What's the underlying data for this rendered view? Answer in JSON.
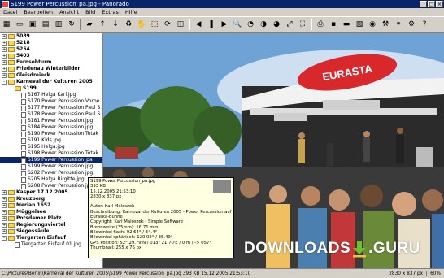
{
  "window": {
    "title": "S199 Power Percussion_pa.jpg - Panorado",
    "controls": [
      "_",
      "□",
      "×"
    ]
  },
  "menu": [
    "Datei",
    "Bearbeiten",
    "Ansicht",
    "Bild",
    "Extras",
    "Hilfe"
  ],
  "toolbar": [
    "grid-icon",
    "monitor-icon",
    "image-icon",
    "filmstrip-icon",
    "slideshow-icon",
    "refresh-icon",
    "new-folder-icon",
    "up-icon",
    "down-icon",
    "recycle-icon",
    "hand-icon",
    "zoom-region-icon",
    "rotate-icon",
    "crop-icon",
    "prev-icon",
    "pause-icon",
    "next-icon",
    "zoom-icon",
    "zoom-50-icon",
    "zoom-100-icon",
    "zoom-200-icon",
    "fit-icon",
    "fullscreen-icon",
    "print-icon",
    "save-icon",
    "scanner-icon",
    "photo-icon",
    "camera-icon",
    "tools-icon",
    "link-icon",
    "settings-icon",
    "question-icon"
  ],
  "tree": [
    {
      "label": "5089",
      "indent": 1,
      "exp": "+",
      "kind": "folder",
      "bold": true
    },
    {
      "label": "5218",
      "indent": 1,
      "exp": "+",
      "kind": "folder",
      "bold": true
    },
    {
      "label": "5254",
      "indent": 1,
      "exp": "+",
      "kind": "folder",
      "bold": true
    },
    {
      "label": "5403",
      "indent": 1,
      "exp": "+",
      "kind": "folder",
      "bold": true
    },
    {
      "label": "Fernsehturm",
      "indent": 1,
      "exp": "+",
      "kind": "folder",
      "bold": true
    },
    {
      "label": "Friedenau Winterbilder",
      "indent": 1,
      "exp": "+",
      "kind": "folder",
      "bold": true
    },
    {
      "label": "Gleisdreieck",
      "indent": 1,
      "exp": "+",
      "kind": "folder",
      "bold": true
    },
    {
      "label": "Karneval der Kulturen 2005",
      "indent": 1,
      "exp": "-",
      "kind": "folder",
      "bold": true
    },
    {
      "label": "S199",
      "indent": 2,
      "exp": "",
      "kind": "folder",
      "bold": true
    },
    {
      "label": "S167 Helga Karl.jpg",
      "indent": 3,
      "exp": "",
      "kind": "file"
    },
    {
      "label": "S170 Power Percussion Vorbe",
      "indent": 3,
      "exp": "",
      "kind": "file"
    },
    {
      "label": "S177 Power Percussion Paul S",
      "indent": 3,
      "exp": "",
      "kind": "file"
    },
    {
      "label": "S178 Power Percussion Paul S",
      "indent": 3,
      "exp": "",
      "kind": "file"
    },
    {
      "label": "S181 Power Percussion.jpg",
      "indent": 3,
      "exp": "",
      "kind": "file"
    },
    {
      "label": "S184 Power Percussion.jpg",
      "indent": 3,
      "exp": "",
      "kind": "file"
    },
    {
      "label": "S190 Power Percussion Totak",
      "indent": 3,
      "exp": "",
      "kind": "file"
    },
    {
      "label": "S191 Kids.jpg",
      "indent": 3,
      "exp": "",
      "kind": "file"
    },
    {
      "label": "S195 Helga.jpg",
      "indent": 3,
      "exp": "",
      "kind": "file"
    },
    {
      "label": "S198 Power Percussion Totak",
      "indent": 3,
      "exp": "",
      "kind": "file"
    },
    {
      "label": "S199 Power Percussion_pa",
      "indent": 3,
      "exp": "",
      "kind": "file",
      "selected": true
    },
    {
      "label": "S199 Power Percussion.jpg",
      "indent": 3,
      "exp": "",
      "kind": "file"
    },
    {
      "label": "S202 Power Percussion.jpg",
      "indent": 3,
      "exp": "",
      "kind": "file"
    },
    {
      "label": "S205 Helga Birgitte.jpg",
      "indent": 3,
      "exp": "",
      "kind": "file"
    },
    {
      "label": "S208 Power Percussion.jpg",
      "indent": 3,
      "exp": "",
      "kind": "file"
    },
    {
      "label": "Kasper 17.12.2005",
      "indent": 1,
      "exp": "+",
      "kind": "folder",
      "bold": true
    },
    {
      "label": "Kreuzberg",
      "indent": 1,
      "exp": "+",
      "kind": "folder",
      "bold": true
    },
    {
      "label": "Merian 1652",
      "indent": 1,
      "exp": "+",
      "kind": "folder",
      "bold": true
    },
    {
      "label": "Müggelsee",
      "indent": 1,
      "exp": "+",
      "kind": "folder",
      "bold": true
    },
    {
      "label": "Potsdamer Platz",
      "indent": 1,
      "exp": "+",
      "kind": "folder",
      "bold": true
    },
    {
      "label": "Regierungsviertel",
      "indent": 1,
      "exp": "+",
      "kind": "folder",
      "bold": true
    },
    {
      "label": "Siegessäule",
      "indent": 1,
      "exp": "+",
      "kind": "folder",
      "bold": true
    },
    {
      "label": "Tiergarten Eisfauf",
      "indent": 1,
      "exp": "-",
      "kind": "folder",
      "bold": true
    },
    {
      "label": "Tiergarten Eisfauf 01.jpg",
      "indent": 2,
      "exp": "",
      "kind": "file"
    }
  ],
  "tooltip": {
    "lines": [
      "S199 Power Percussion_pa.jpg",
      "393 KB",
      "15.12.2005 21:53:10",
      "2830 x 837 px",
      "",
      "Autor: Karl Maloszek",
      "Beschreibung: Karneval der Kulturen 2005 - Power Percussion auf der",
      "Euraska-Bühne",
      "Copyright: Karl Maloszek - Simple Software",
      "Brennweite (35mm): 16.71 mm",
      "Bildwinkel flach: 92.64° / 34.4°",
      "Bildwinkel sphärisch: 120.02° / 35.49°",
      "GPS Position: 52° 29.79'N / 013° 21.70'E / 0 m / -> 057°",
      "Thumbnail: 255 x 76 px"
    ]
  },
  "image": {
    "banner_text": "EURASTA"
  },
  "watermark": {
    "text_left": "DOWNLOADS",
    "text_right": ".GURU"
  },
  "status": {
    "path": "C:\\Pictures\\Berlin\\Karneval der Kulturen 2005\\S199 Power Percussion_pa.jpg  393 KB  15.12.2005 21:53:10",
    "dims": "2830 x 837 px",
    "zoom": "60%"
  },
  "colors": {
    "titlebar": "#0a246a",
    "selection": "#0a246a",
    "tooltip_bg": "#ffffe1",
    "sky": "#6fa3d6",
    "banner_red": "#d8282c",
    "stage_white": "#f2f2f2",
    "watermark_green": "#6fbf2a"
  }
}
